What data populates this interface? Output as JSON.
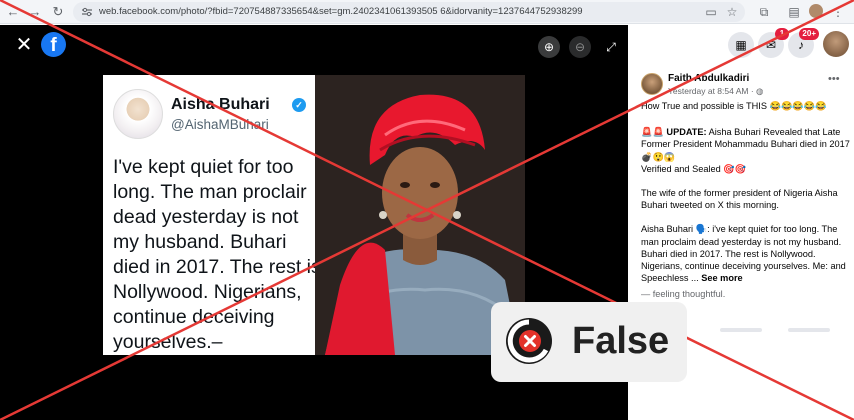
{
  "browser": {
    "url": "web.facebook.com/photo/?fbid=720754887335654&set=gm.2402341061393505 6&idorvanity=1237644752938299"
  },
  "viewer": {
    "close_glyph": "✕",
    "logo_letter": "f",
    "zoom_in_glyph": "⊕",
    "zoom_out_glyph": "⊖",
    "fullscreen_glyph": "⤢"
  },
  "tweet": {
    "name": "Aisha Buhari",
    "handle": "@AishaMBuhari",
    "verified_glyph": "✓",
    "body": "I've kept quiet for too long. The man proclair dead yesterday is not my husband. Buhari died in 2017. The rest is Nollywood. Nigerians, continue deceiving yourselves.–"
  },
  "header": {
    "messenger_badge": "1",
    "notifications_badge": "20+"
  },
  "post": {
    "author": "Faith Abdulkadiri",
    "time": "Yesterday at 8:54 AM · ",
    "more_glyph": "•••",
    "line1": "How True and possible is THIS 😂😂😂😂😂",
    "update_prefix": "🚨🚨 UPDATE:",
    "update_text": " Aisha Buhari Revealed that Late Former President Mohammadu Buhari died in 2017💣😲😱",
    "verified_line": "Verified and Sealed 🎯🎯",
    "paragraph2": "The wife of the former president of Nigeria Aisha Buhari tweeted on X this morning.",
    "paragraph3": "Aisha Buhari 🗣️: i've kept quiet for too long. The man proclaim dead yesterday is not my husband. Buhari died in 2017. The rest is Nollywood. Nigerians, continue deceiving yourselves. Me: and Speechless ... ",
    "see_more": "See more",
    "feeling": "— feeling thoughtful."
  },
  "verdict": {
    "label": "False",
    "color": "#e3322b"
  }
}
